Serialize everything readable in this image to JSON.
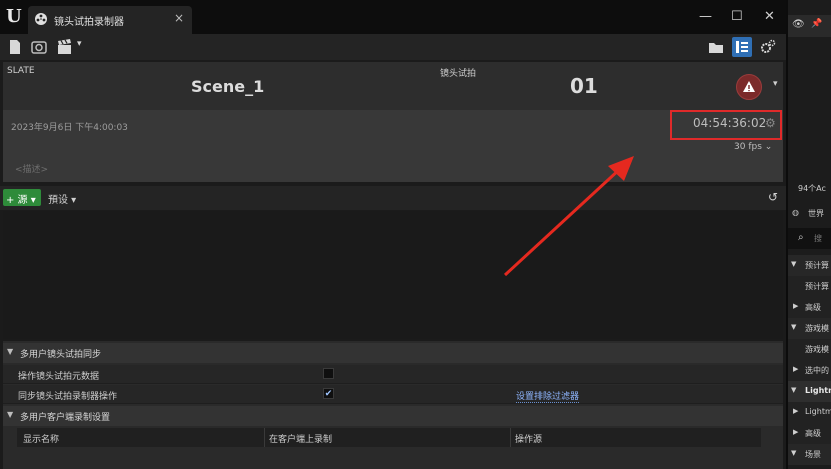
{
  "window": {
    "tab_title": "镜头试拍录制器",
    "tab_close": "×",
    "controls": {
      "minimize": "—",
      "maximize": "☐",
      "close": "✕"
    }
  },
  "toolbar": {
    "left_icons": [
      "document-icon",
      "camera-icon",
      "clapper-icon"
    ],
    "right_icons": [
      "folder-icon",
      "panel-icon",
      "settings-icon"
    ]
  },
  "slate": {
    "label": "SLATE",
    "scene": "Scene_1",
    "take_label": "镜头试拍",
    "take": "01",
    "warning_glyph": "!",
    "dropdown": "▾",
    "date": "2023年9月6日 下午4:00:03",
    "timecode": "04:54:36:02",
    "fps": "30 fps ⌄",
    "description_placeholder": "<描述>"
  },
  "sources_bar": {
    "add_source_label": "+ 源 ▾",
    "presets_label": "預设 ▾",
    "undo_glyph": "↺"
  },
  "details": {
    "sections": [
      {
        "title": "多用户镜头试拍同步",
        "rows": [
          {
            "label": "操作镜头试拍元数据",
            "checked": false
          },
          {
            "label": "同步镜头试拍录制器操作",
            "checked": true,
            "link": "设置排除过滤器"
          }
        ]
      },
      {
        "title": "多用户客户端录制设置",
        "columns": [
          "显示名称",
          "在客户端上录制",
          "操作源"
        ]
      }
    ],
    "check_glyph": "✔"
  },
  "right_panel": {
    "items": [
      "94个Ac",
      "世界",
      "搜",
      "预计算",
      "预计算",
      "高级",
      "游戏模",
      "游戏模",
      "选中的",
      "Lightm",
      "Lightm",
      "高级",
      "场景"
    ]
  },
  "colors": {
    "accent_blue": "#2f6fb5",
    "add_source_green": "#2e8b3a",
    "highlight_red": "#e02a2a",
    "warning_red": "#7b2a2a"
  }
}
